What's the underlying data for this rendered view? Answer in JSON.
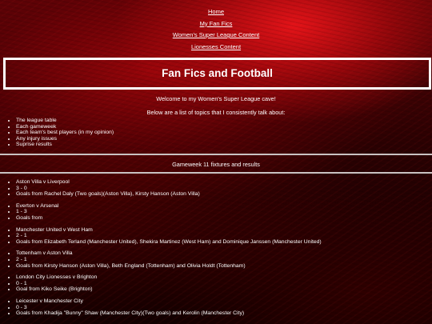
{
  "nav": {
    "links": [
      "Home",
      "My Fan Fics",
      "Women's Super League Content",
      "Lionesses Content"
    ]
  },
  "header": {
    "title": "Fan Fics and Football"
  },
  "intro": {
    "welcome": "Welcome to my Women's Super League cave!",
    "topics_intro": "Below are a list of topics that I consistently talk about:"
  },
  "topics": [
    "The league table",
    "Each gameweek",
    "Each team's best players (in my opinion)",
    "Any injury issues",
    "Suprise results"
  ],
  "gameweek": {
    "title": "Gameweek 11 fixtures and results",
    "fixtures": [
      {
        "match": "Aston Villa v Liverpool",
        "score": "3 - 0",
        "goals": "Goals from Rachel Daly (Two goals)(Aston Villa), Kirsty Hanson (Aston Villa)"
      },
      {
        "match": "Everton v Arsenal",
        "score": "1 - 3",
        "goals": "Goals from"
      },
      {
        "match": "Manchester United v West Ham",
        "score": "2 - 1",
        "goals": "Goals from Elizabeth Terland (Manchester United), Shekira Martinez (West Ham) and Dominique Janssen (Manchester United)"
      },
      {
        "match": "Tottenham v Aston Villa",
        "score": "2 - 1",
        "goals": "Goals from Kirsty Hanson (Aston Villa), Beth England (Tottenham) and Olivia Holdt (Tottenham)"
      },
      {
        "match": "London City Lionesses v Brighton",
        "score": "0 - 1",
        "goals": "Goal from Kiko Seike (Brighton)"
      },
      {
        "match": "Leicester v Manchester City",
        "score": "0 - 3",
        "goals": "Goals from Khadija \"Bunny\" Shaw (Manchester City)(Two goals) and Kerolin (Manchester City)"
      }
    ]
  }
}
